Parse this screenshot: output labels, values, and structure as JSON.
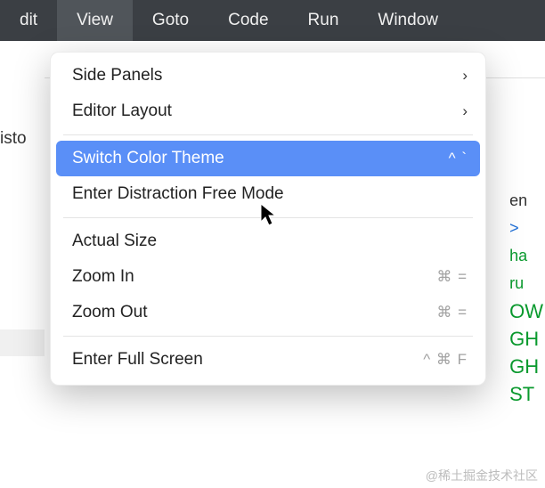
{
  "menubar": {
    "items": [
      "dit",
      "View",
      "Goto",
      "Code",
      "Run",
      "Window"
    ],
    "selected_index": 1
  },
  "left": {
    "label": "isto"
  },
  "dropdown": {
    "groups": [
      [
        {
          "label": "Side Panels",
          "type": "submenu"
        },
        {
          "label": "Editor Layout",
          "type": "submenu"
        }
      ],
      [
        {
          "label": "Switch Color Theme",
          "type": "item",
          "selected": true,
          "shortcut": "^ `"
        },
        {
          "label": "Enter Distraction Free Mode",
          "type": "item"
        }
      ],
      [
        {
          "label": "Actual Size",
          "type": "item"
        },
        {
          "label": "Zoom In",
          "type": "item",
          "shortcut": "⌘ ="
        },
        {
          "label": "Zoom Out",
          "type": "item",
          "shortcut": "⌘ ="
        }
      ],
      [
        {
          "label": "Enter Full Screen",
          "type": "item",
          "shortcut": "^ ⌘ F"
        }
      ]
    ]
  },
  "code_fragments": [
    "en",
    ">",
    "ha",
    "ru",
    "OW",
    "GH",
    "GH",
    "ST"
  ],
  "watermark": "@稀土掘金技术社区"
}
